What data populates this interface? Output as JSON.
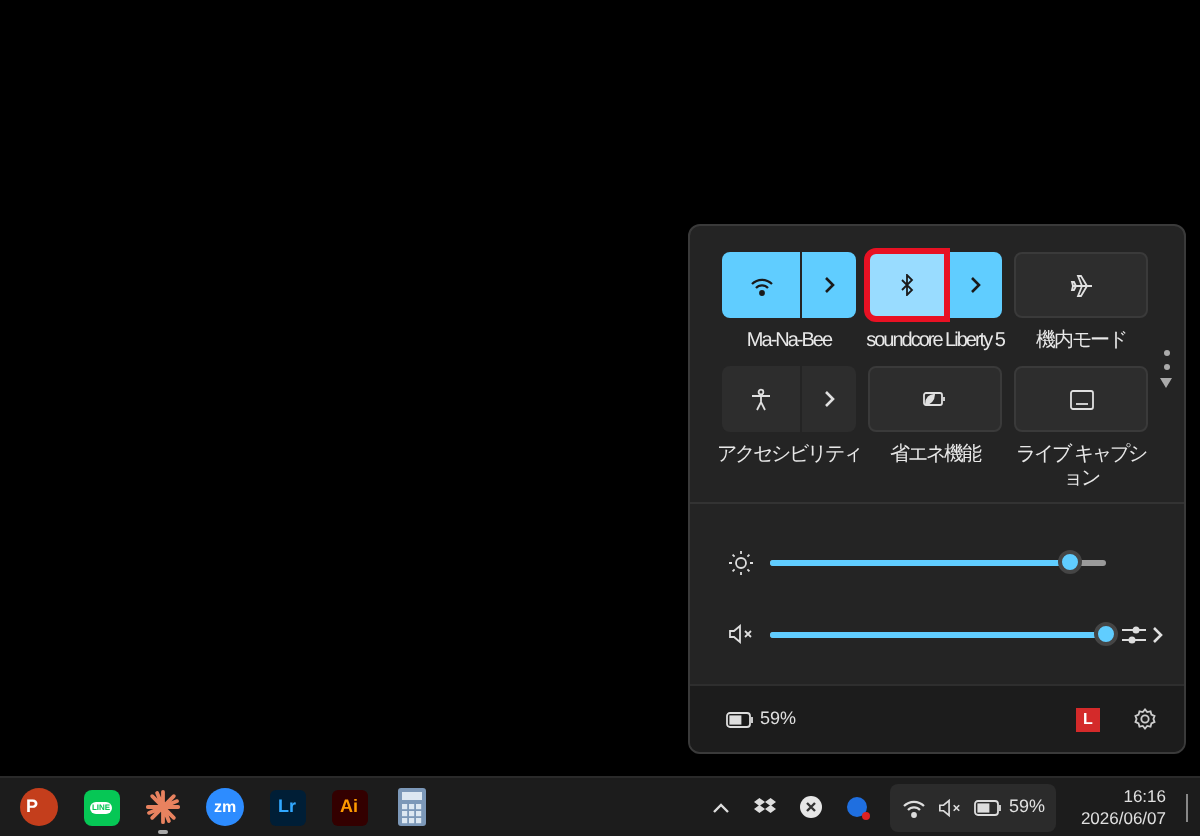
{
  "quick_settings": {
    "tiles": [
      {
        "kind": "wifi",
        "label": "Ma-Na-Bee",
        "on": true,
        "has_arrow": true,
        "highlighted": false
      },
      {
        "kind": "bluetooth",
        "label": "soundcore Liberty 5",
        "on": true,
        "has_arrow": true,
        "highlighted": true
      },
      {
        "kind": "airplane",
        "label": "機内モード",
        "on": false,
        "has_arrow": false,
        "highlighted": false
      },
      {
        "kind": "accessibility",
        "label": "アクセシビリティ",
        "on": false,
        "has_arrow": true,
        "highlighted": false
      },
      {
        "kind": "battery-saver",
        "label": "省エネ機能",
        "on": false,
        "has_arrow": false,
        "highlighted": false
      },
      {
        "kind": "captions",
        "label": "ライブ キャプション",
        "on": false,
        "has_arrow": false,
        "highlighted": false
      }
    ],
    "sliders": [
      {
        "kind": "brightness",
        "level": 0.89
      },
      {
        "kind": "volume",
        "level": 1.0,
        "muted": true,
        "has_output_menu": true
      }
    ],
    "battery": "59%",
    "badge": "L"
  },
  "taskbar": {
    "apps": [
      {
        "kind": "powerpoint",
        "label": "P",
        "running": false
      },
      {
        "kind": "line",
        "label": "LINE",
        "running": false
      },
      {
        "kind": "starburst",
        "running": true
      },
      {
        "kind": "zoom",
        "label": "zm",
        "running": false
      },
      {
        "kind": "lightroom",
        "label": "Lr",
        "running": false
      },
      {
        "kind": "illustrator",
        "label": "Ai",
        "running": false
      },
      {
        "kind": "calculator",
        "running": false
      }
    ],
    "battery": "59%",
    "time": "16:16",
    "date": "2026/06/07"
  }
}
